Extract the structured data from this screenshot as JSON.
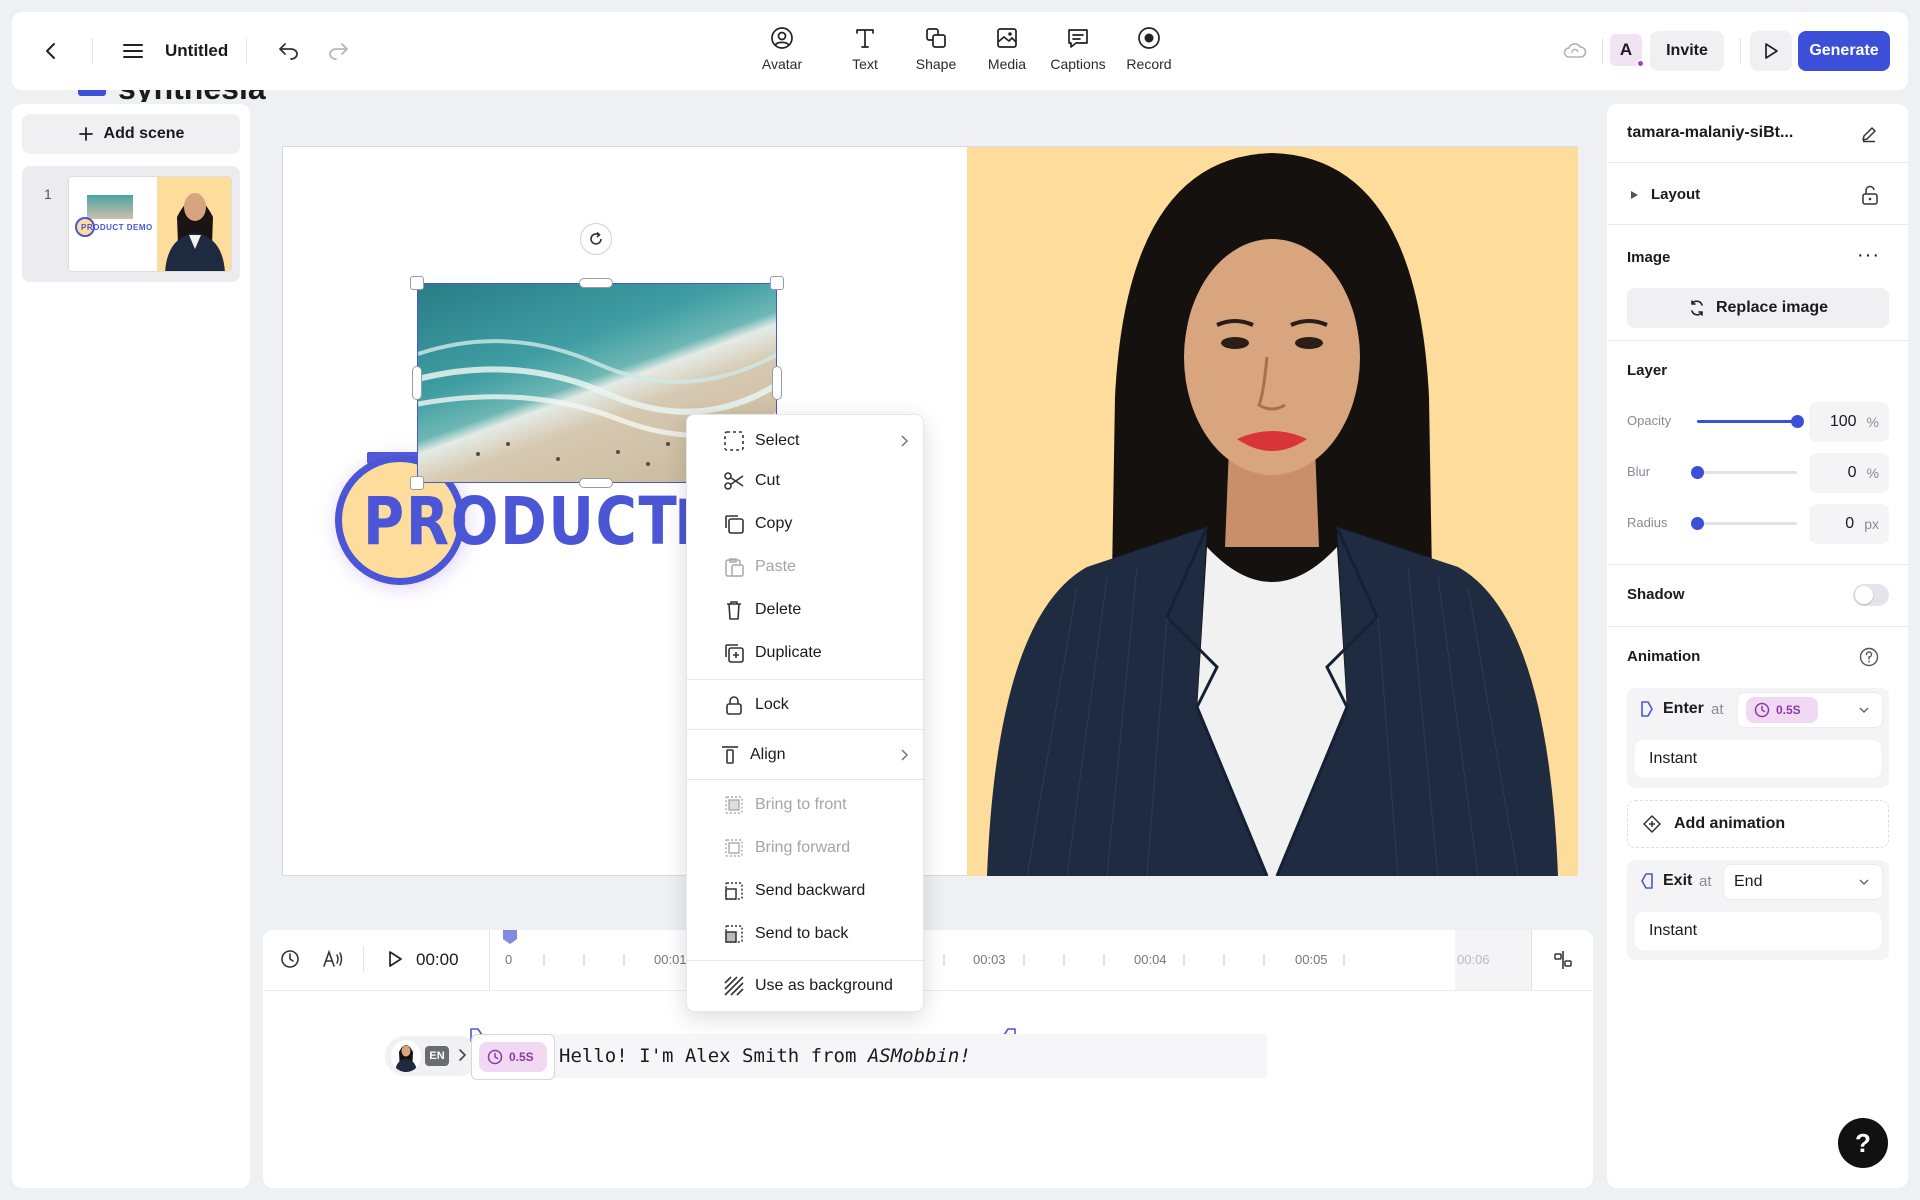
{
  "topbar": {
    "title": "Untitled",
    "tools": [
      {
        "label": "Avatar",
        "icon": "avatar-icon"
      },
      {
        "label": "Text",
        "icon": "text-icon"
      },
      {
        "label": "Shape",
        "icon": "shape-icon"
      },
      {
        "label": "Media",
        "icon": "media-icon"
      },
      {
        "label": "Captions",
        "icon": "captions-icon"
      },
      {
        "label": "Record",
        "icon": "record-icon"
      }
    ],
    "user_initial": "A",
    "invite_label": "Invite",
    "generate_label": "Generate"
  },
  "brand_peek": "synthesia",
  "scenes": {
    "add_label": "Add scene",
    "items": [
      {
        "number": "1",
        "thumb_text": "PRODUCT DEMO"
      }
    ]
  },
  "canvas": {
    "headline": "PRODUCT",
    "headline_tail": "I"
  },
  "context_menu": {
    "items": [
      {
        "label": "Select",
        "icon": "select-icon",
        "submenu": true,
        "disabled": false
      },
      {
        "label": "Cut",
        "icon": "scissors-icon",
        "disabled": false
      },
      {
        "label": "Copy",
        "icon": "copy-icon",
        "disabled": false
      },
      {
        "label": "Paste",
        "icon": "paste-icon",
        "disabled": true
      },
      {
        "label": "Delete",
        "icon": "trash-icon",
        "disabled": false
      },
      {
        "label": "Duplicate",
        "icon": "duplicate-icon",
        "disabled": false
      },
      {
        "label": "Lock",
        "icon": "lock-icon",
        "disabled": false
      },
      {
        "label": "Align",
        "icon": "align-icon",
        "submenu": true,
        "disabled": false
      },
      {
        "label": "Bring to front",
        "icon": "bring-to-front-icon",
        "disabled": true
      },
      {
        "label": "Bring forward",
        "icon": "bring-forward-icon",
        "disabled": true
      },
      {
        "label": "Send backward",
        "icon": "send-backward-icon",
        "disabled": false
      },
      {
        "label": "Send to back",
        "icon": "send-to-back-icon",
        "disabled": false
      },
      {
        "label": "Use as background",
        "icon": "background-icon",
        "disabled": false
      }
    ]
  },
  "timeline": {
    "time": "00:00",
    "ticks": [
      "0",
      "00:01",
      "00:03",
      "00:04",
      "00:05",
      "00:06"
    ],
    "language": "EN",
    "clip_duration": "0.5S",
    "script_text": "Hello! I'm Alex Smith from ",
    "script_italic": "ASMobbin!"
  },
  "properties": {
    "filename": "tamara-malaniy-siBt...",
    "layout_label": "Layout",
    "image_section": "Image",
    "replace_label": "Replace image",
    "layer_section": "Layer",
    "opacity_label": "Opacity",
    "opacity_value": "100",
    "opacity_unit": "%",
    "opacity_level": 1.0,
    "blur_label": "Blur",
    "blur_value": "0",
    "blur_unit": "%",
    "radius_label": "Radius",
    "radius_value": "0",
    "radius_unit": "px",
    "shadow_label": "Shadow",
    "shadow_on": false,
    "animation_section": "Animation",
    "enter_label": "Enter",
    "enter_at": "at",
    "enter_time": "0.5S",
    "enter_style": "Instant",
    "add_animation_label": "Add animation",
    "exit_label": "Exit",
    "exit_at": "at",
    "exit_time": "End",
    "exit_style": "Instant"
  },
  "colors": {
    "accent": "#3b4fd8",
    "headline": "#4a56d6",
    "canvas_bg_right": "#fedc9b",
    "purple": "#9b4fd0"
  }
}
